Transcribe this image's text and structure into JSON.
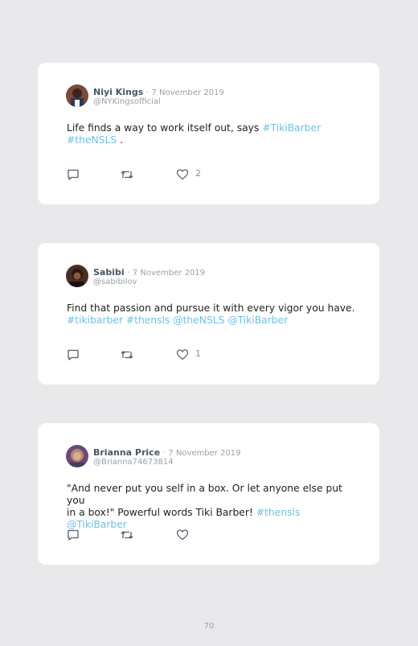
{
  "tweets": [
    {
      "name": "Niyi Kings",
      "date": "7 November 2019",
      "handle": "@NYKingsofficial",
      "avatar": "avatar-photo",
      "text_plain": "Life finds a way to work itself out, says ",
      "link1": "#TikiBarber",
      "link2": "#theNSLS",
      "text_end": " .",
      "likes": "2"
    },
    {
      "name": "Sabibi",
      "date": "7 November 2019",
      "handle": "@sabibilov",
      "avatar": "avatar-photo",
      "line1": "Find that passion and pursue it with every vigor you have.",
      "links": [
        "#tikibarber",
        "#thensls",
        "@theNSLS",
        "@TikiBarber"
      ],
      "likes": "1"
    },
    {
      "name": "Brianna Price",
      "date": "7 November 2019",
      "handle": "@Brianna74673814",
      "avatar": "avatar-photo",
      "line1": "\"And never put you self in a box. Or let anyone else put you",
      "line2_plain": "in a box!\" Powerful words Tiki Barber! ",
      "links": [
        "#thensls",
        "@TikiBarber"
      ],
      "likes": ""
    }
  ],
  "icons": {
    "reply": "reply-icon",
    "retweet": "retweet-icon",
    "like": "heart-icon"
  },
  "colors": {
    "background": "#e9e9ec",
    "card": "#ffffff",
    "link": "#6ec1e6"
  },
  "page_number": "70"
}
